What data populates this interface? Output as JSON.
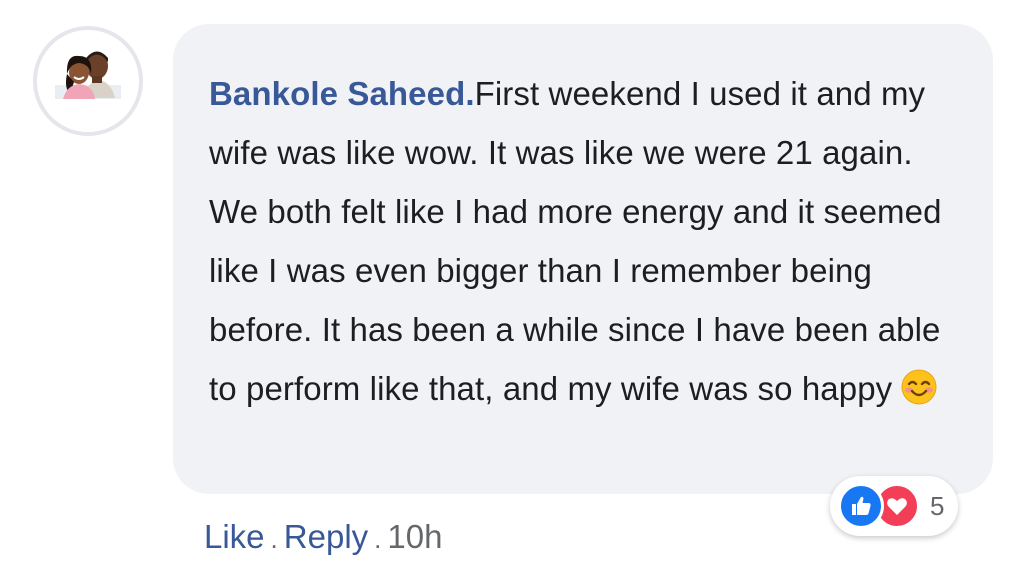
{
  "comment": {
    "author": "Bankole Saheed.",
    "text": "First weekend I used it and my wife was like wow. It was like we were 21 again. We both felt like I had more energy and it seemed like I was even bigger than I remember being before. It has been a while since I have been able to perform like that, and my wife was so happy",
    "emoji": "smiling-face-emoji"
  },
  "reactions": {
    "types": [
      "like-icon",
      "love-icon"
    ],
    "count": "5",
    "colors": {
      "like": "#1877f2",
      "love": "#f33e58"
    }
  },
  "actions": {
    "like_label": "Like",
    "separator": ".",
    "reply_label": "Reply",
    "time": "10h"
  },
  "colors": {
    "bubble": "#f0f2f5",
    "author": "#385898",
    "text": "#1c1e21",
    "meta": "#65676b"
  }
}
